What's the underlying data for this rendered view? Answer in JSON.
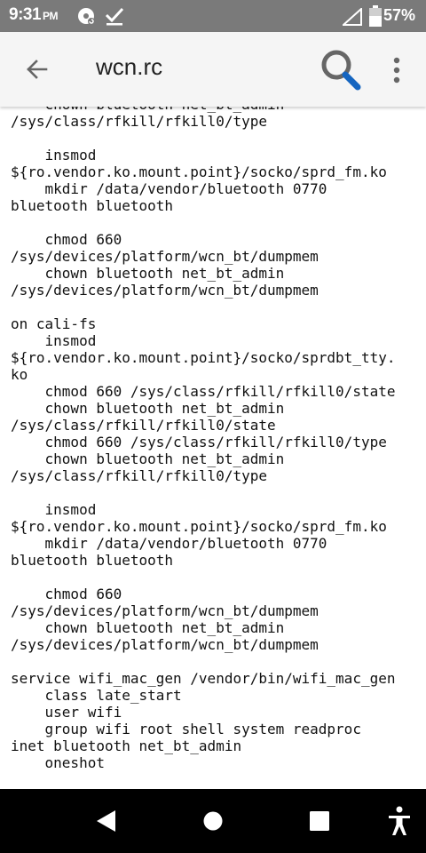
{
  "status_bar": {
    "time": "9:31",
    "ampm": "PM",
    "battery_percent": "57%",
    "icons": [
      "sync-disc-icon",
      "check-icon",
      "cell-signal-icon",
      "battery-icon"
    ]
  },
  "app_bar": {
    "title": "wcn.rc",
    "icons": [
      "back-arrow-icon",
      "search-icon",
      "more-vert-icon"
    ]
  },
  "file_content": "    chown bluetooth net_bt_admin\n/sys/class/rfkill/rfkill0/type\n\n    insmod\n${ro.vendor.ko.mount.point}/socko/sprd_fm.ko\n    mkdir /data/vendor/bluetooth 0770\nbluetooth bluetooth\n\n    chmod 660\n/sys/devices/platform/wcn_bt/dumpmem\n    chown bluetooth net_bt_admin\n/sys/devices/platform/wcn_bt/dumpmem\n\non cali-fs\n    insmod\n${ro.vendor.ko.mount.point}/socko/sprdbt_tty.\nko\n    chmod 660 /sys/class/rfkill/rfkill0/state\n    chown bluetooth net_bt_admin\n/sys/class/rfkill/rfkill0/state\n    chmod 660 /sys/class/rfkill/rfkill0/type\n    chown bluetooth net_bt_admin\n/sys/class/rfkill/rfkill0/type\n\n    insmod\n${ro.vendor.ko.mount.point}/socko/sprd_fm.ko\n    mkdir /data/vendor/bluetooth 0770\nbluetooth bluetooth\n\n    chmod 660\n/sys/devices/platform/wcn_bt/dumpmem\n    chown bluetooth net_bt_admin\n/sys/devices/platform/wcn_bt/dumpmem\n\nservice wifi_mac_gen /vendor/bin/wifi_mac_gen\n    class late_start\n    user wifi\n    group wifi root shell system readproc\ninet bluetooth net_bt_admin\n    oneshot",
  "nav_bar": {
    "icons": [
      "back-triangle-icon",
      "home-circle-icon",
      "recents-square-icon",
      "accessibility-icon"
    ]
  },
  "colors": {
    "status_bar": "#7a7a7a",
    "app_bar": "#f5f5f5",
    "search_handle": "#1565c0",
    "nav_bar": "#000000"
  }
}
